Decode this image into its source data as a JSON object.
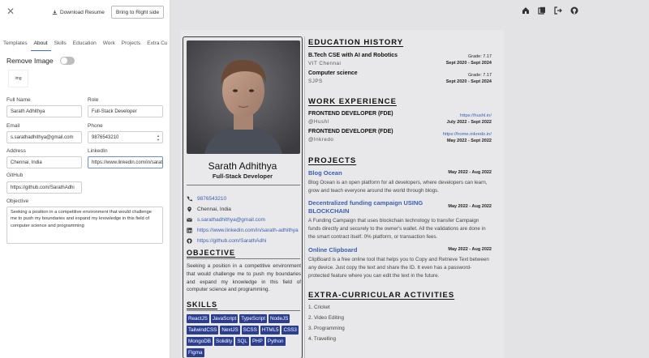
{
  "panel": {
    "close_icon": "close-icon",
    "download_label": "Download Resume",
    "bring_label": "Bring to Right side",
    "tabs": [
      "Templates",
      "About",
      "Skills",
      "Education",
      "Work",
      "Projects",
      "Extra Cu"
    ],
    "active_tab": "About",
    "remove_image_label": "Remove Image",
    "image_thumb_label": "img",
    "fields": {
      "full_name": {
        "label": "Full Name",
        "value": "Sarath Adhithya"
      },
      "role": {
        "label": "Role",
        "value": "Full-Stack Developer"
      },
      "email": {
        "label": "Email",
        "value": "s.sarathadhithya@gmail.com"
      },
      "phone": {
        "label": "Phone",
        "value": "9876543210"
      },
      "address": {
        "label": "Address",
        "value": "Chennai, India"
      },
      "linkedin": {
        "label": "LinkedIn",
        "value": "https://www.linkedin.com/in/sarat"
      },
      "github": {
        "label": "GitHub",
        "value": "https://github.com/SarathAdhi"
      },
      "objective": {
        "label": "Objective",
        "value": "Seeking a position in a competitive environment that would challenge me to push my boundaries and expand my knowledge in this field of computer science and programming"
      }
    }
  },
  "toolbar": {
    "icons": [
      "home-icon",
      "copy-icon",
      "logout-icon",
      "github-icon"
    ]
  },
  "resume": {
    "name": "Sarath Adhithya",
    "role": "Full-Stack Developer",
    "contacts": [
      {
        "icon": "phone-icon",
        "text": "9876543210",
        "link": true
      },
      {
        "icon": "location-icon",
        "text": "Chennai, India",
        "link": false
      },
      {
        "icon": "mail-icon",
        "text": "s.sarathadhithya@gmail.com",
        "link": true
      },
      {
        "icon": "linkedin-icon",
        "text": "https://www.linkedin.com/in/sarath-adhithya",
        "link": true
      },
      {
        "icon": "github-icon",
        "text": "https://github.com/SarathAdhi",
        "link": true
      }
    ],
    "objective_title": "OBJECTIVE",
    "objective": "Seeking a position in a competitive environment that would challenge me to push my boundaries and expand my knowledge in this field of computer science and programming.",
    "skills_title": "SKILLS",
    "skills": [
      "ReactJS",
      "JavaScript",
      "TypeScript",
      "NodeJS",
      "TailwindCSS",
      "NextJS",
      "SCSS",
      "HTML5",
      "CSS3",
      "MongoDB",
      "Solidity",
      "SQL",
      "PHP",
      "Python",
      "Figma"
    ],
    "education_title": "EDUCATION HISTORY",
    "education": [
      {
        "title": "B.Tech CSE with AI and Robotics",
        "school": "VIT Chennai",
        "grade": "Grade: 7.17",
        "dates": "Sept 2020 - Sept 2024"
      },
      {
        "title": "Computer science",
        "school": "SJPS",
        "grade": "Grade: 7.17",
        "dates": "Sept 2020 - Sept 2024"
      }
    ],
    "work_title": "WORK EXPERIENCE",
    "work": [
      {
        "title": "FRONTEND DEVELOPER (FDE)",
        "company": "@Hushl",
        "link": "https://hushl.in/",
        "dates": "July 2022 - Sept 2022"
      },
      {
        "title": "FRONTEND DEVELOPER (FDE)",
        "company": "@Inkredo",
        "link": "https://home.inkredo.in/",
        "dates": "May 2022 - Sept 2022"
      }
    ],
    "projects_title": "PROJECTS",
    "projects": [
      {
        "title": "Blog Ocean",
        "dates": "May 2022 - Aug 2022",
        "desc": "Blog Ocean is an open platform for all developers, where developers can learn, grow and teach everyone around the world through blogs."
      },
      {
        "title": "Decentralized funding campaign USING BLOCKCHAIN",
        "dates": "May 2022 - Aug 2022",
        "desc": "A Funding Campaign that uses blockchain technology to transfer Campaign funds directly and securely to the owner's wallet. All the validations are done in the smart contract itself. 0% platform, or transaction fees."
      },
      {
        "title": "Online Clipboard",
        "dates": "May 2022 - Aug 2022",
        "desc": "ClipBoard is a free online tool that helps you to Copy and Retrieve Text between any device. Just copy the text and share the ID. It even has a password-protected feature where you can edit the text in the future."
      }
    ],
    "extra_title": "EXTRA-CURRICULAR ACTIVITIES",
    "extra": [
      "1. Cricket",
      "2. Video Editing",
      "3. Programming",
      "4. Travelling"
    ]
  },
  "colors": {
    "accent": "#3a5fb0",
    "chip": "#2b3e8f",
    "overlay": "#e3e3e6"
  }
}
